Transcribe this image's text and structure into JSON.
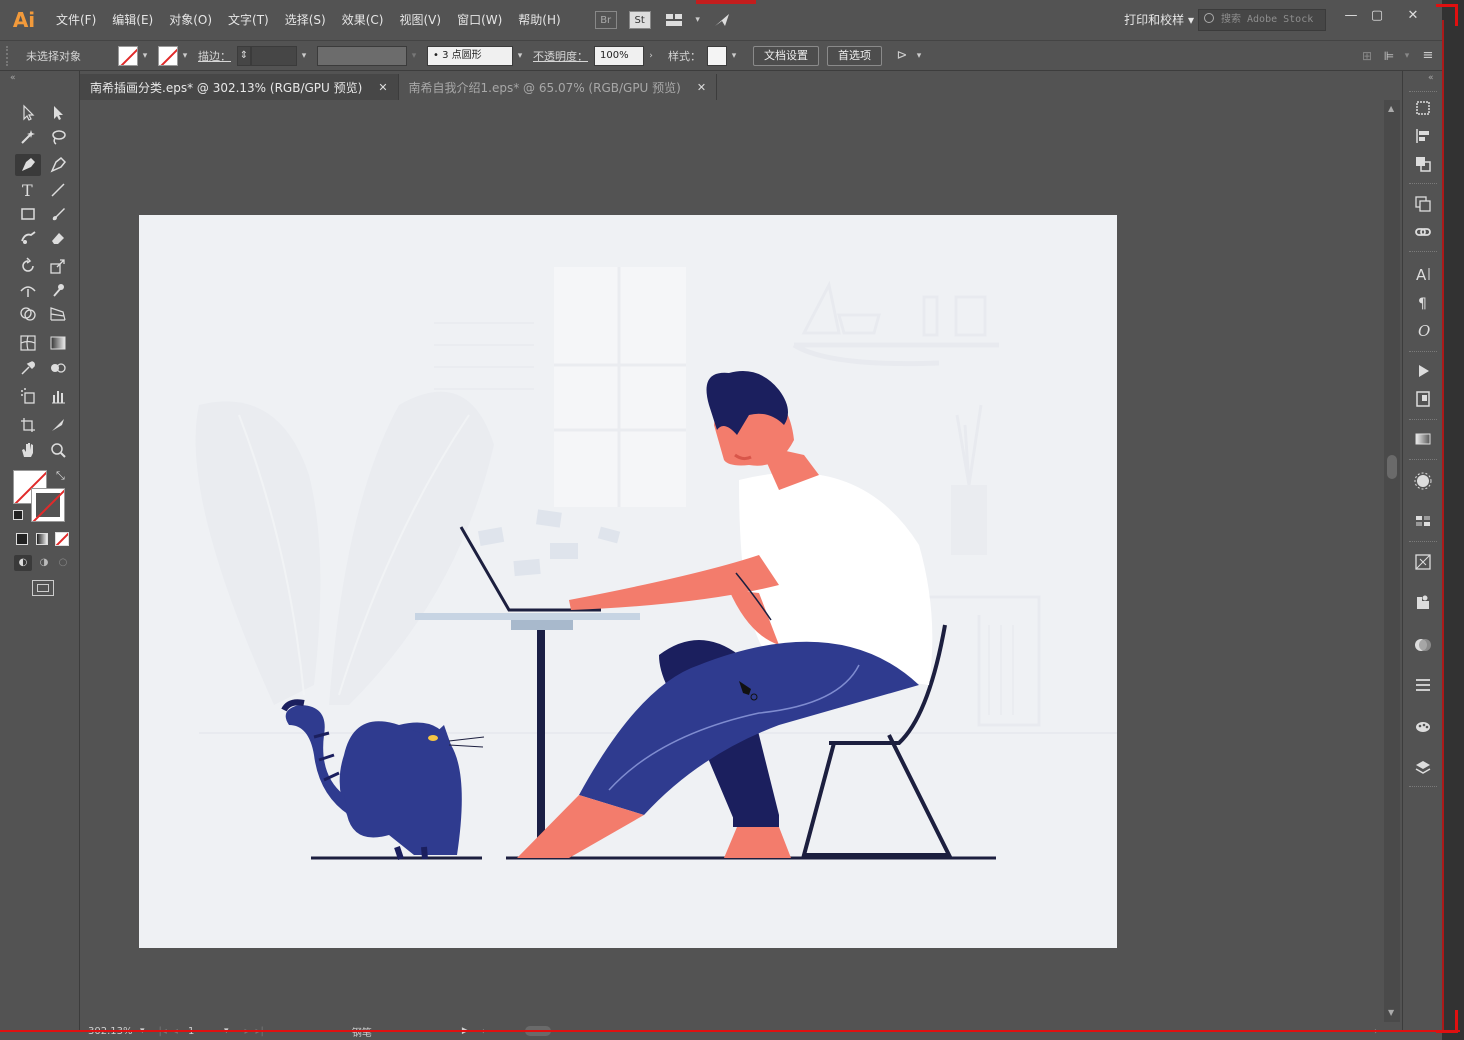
{
  "app": {
    "logo": "Ai"
  },
  "menu": [
    "文件(F)",
    "编辑(E)",
    "对象(O)",
    "文字(T)",
    "选择(S)",
    "效果(C)",
    "视图(V)",
    "窗口(W)",
    "帮助(H)"
  ],
  "menubar_icons": {
    "bridge": "Br",
    "stock": "St"
  },
  "workspace": "打印和校样",
  "search_placeholder": "搜索 Adobe Stock",
  "control": {
    "selection_status": "未选择对象",
    "stroke_label": "描边：",
    "brush_value": "3 点圆形",
    "opacity_label": "不透明度：",
    "opacity_value": "100%",
    "style_label": "样式：",
    "doc_setup_button": "文档设置",
    "preferences_button": "首选项"
  },
  "tabs": [
    {
      "label": "南希插画分类.eps* @ 302.13% (RGB/GPU 预览)",
      "active": true
    },
    {
      "label": "南希自我介绍1.eps* @ 65.07% (RGB/GPU 预览)",
      "active": false
    }
  ],
  "status": {
    "zoom": "302.13%",
    "artboard": "1",
    "tool": "钢笔"
  },
  "colors": {
    "accent": "#f29a3b",
    "ui_bg": "#535353",
    "artboard_bg": "#eff1f4",
    "navy": "#2f3b8f",
    "skin": "#f37c6c",
    "hair": "#1b1f5e"
  }
}
